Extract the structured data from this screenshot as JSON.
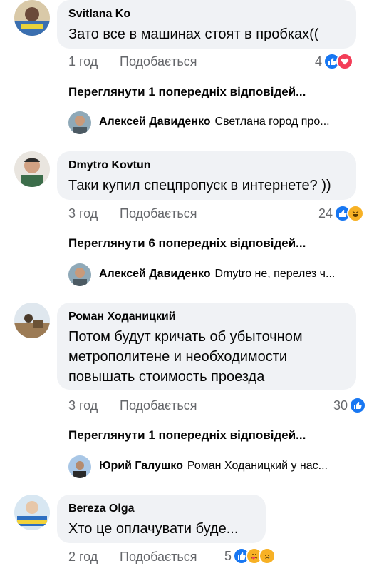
{
  "comments": [
    {
      "author": "Svitlana Ko",
      "text": "Зато все в машинах стоят в пробках((",
      "time": "1 год",
      "like_label": "Подобається",
      "reaction_count": "4",
      "reactions": [
        "like-icon",
        "love-icon"
      ],
      "view_replies": "Переглянути 1 попередніх відповідей...",
      "reply": {
        "author": "Алексей Давиденко",
        "text": "Светлана город про..."
      }
    },
    {
      "author": "Dmytro Kovtun",
      "text": "Таки купил спецпропуск в интернете? ))",
      "time": "3 год",
      "like_label": "Подобається",
      "reaction_count": "24",
      "reactions": [
        "like-icon",
        "haha-icon"
      ],
      "view_replies": "Переглянути 6 попередніх відповідей...",
      "reply": {
        "author": "Алексей Давиденко",
        "text": "Dmytro не, перелез ч..."
      }
    },
    {
      "author": "Роман Ходаницкий",
      "text_lines": [
        "Потом будут кричать об убыточном",
        "метрополитене и необходимости",
        "повышать стоимость проезда"
      ],
      "time": "3 год",
      "like_label": "Подобається",
      "reaction_count": "30",
      "reactions": [
        "like-icon"
      ],
      "view_replies": "Переглянути 1 попередніх відповідей...",
      "reply": {
        "author": "Юрий Галушко",
        "text": "Роман Ходаницкий у нас..."
      }
    },
    {
      "author": "Bereza Olga",
      "text": "Хто це оплачувати буде...",
      "time": "2 год",
      "like_label": "Подобається",
      "reaction_count": "5",
      "reactions": [
        "like-icon",
        "care-icon",
        "sad-icon"
      ]
    }
  ],
  "colors": {
    "bubble": "#f0f2f5",
    "meta_text": "#65676b",
    "like_blue": "#1877f2",
    "love_red": "#f33e58",
    "haha_yellow": "#f7b125"
  }
}
